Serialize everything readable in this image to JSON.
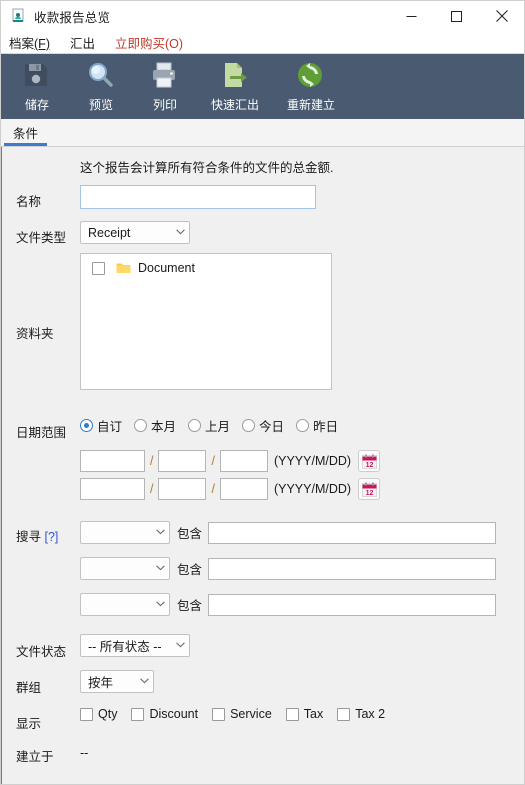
{
  "window": {
    "title": "收款报告总览",
    "icon": "report-app-icon",
    "controls": {
      "minimize": "minimize-icon",
      "maximize": "maximize-icon",
      "close": "close-icon"
    }
  },
  "menubar": {
    "items": [
      {
        "label": "档案",
        "mnemonic": "(F)",
        "accent": false
      },
      {
        "label": "汇出",
        "mnemonic": "",
        "accent": false
      },
      {
        "label": "立即购买",
        "mnemonic": "(O)",
        "accent": true
      }
    ]
  },
  "toolbar": {
    "background": "#4a5a70",
    "items": [
      {
        "label": "储存",
        "icon": "save-floppy-icon"
      },
      {
        "label": "预览",
        "icon": "preview-magnifier-icon"
      },
      {
        "label": "列印",
        "icon": "print-printer-icon"
      },
      {
        "label": "快速汇出",
        "icon": "quick-export-icon"
      },
      {
        "label": "重新建立",
        "icon": "rebuild-refresh-icon"
      }
    ]
  },
  "tabs": [
    {
      "label": "条件",
      "active": true
    }
  ],
  "form": {
    "description": "这个报告会计算所有符合条件的文件的总金额.",
    "name": {
      "label": "名称",
      "value": "",
      "placeholder": ""
    },
    "doc_type": {
      "label": "文件类型",
      "value": "Receipt"
    },
    "folders": {
      "label": "资料夹",
      "items": [
        {
          "label": "Document",
          "checked": false,
          "icon": "folder-icon"
        }
      ]
    },
    "date_range": {
      "label": "日期范围",
      "options": [
        {
          "label": "自订",
          "selected": true
        },
        {
          "label": "本月",
          "selected": false
        },
        {
          "label": "上月",
          "selected": false
        },
        {
          "label": "今日",
          "selected": false
        },
        {
          "label": "昨日",
          "selected": false
        }
      ],
      "format_hint": "(YYYY/M/DD)",
      "separator": "/",
      "calendar_icon": "calendar-icon",
      "rows": [
        {
          "year": "",
          "month": "",
          "day": ""
        },
        {
          "year": "",
          "month": "",
          "day": ""
        }
      ]
    },
    "search": {
      "label": "搜寻",
      "help": "[?]",
      "operator": "包含",
      "rows": [
        {
          "field": "",
          "value": ""
        },
        {
          "field": "",
          "value": ""
        },
        {
          "field": "",
          "value": ""
        }
      ]
    },
    "doc_status": {
      "label": "文件状态",
      "value": "-- 所有状态 --"
    },
    "group": {
      "label": "群组",
      "value": "按年"
    },
    "display": {
      "label": "显示",
      "options": [
        {
          "label": "Qty",
          "checked": false
        },
        {
          "label": "Discount",
          "checked": false
        },
        {
          "label": "Service",
          "checked": false
        },
        {
          "label": "Tax",
          "checked": false
        },
        {
          "label": "Tax 2",
          "checked": false
        }
      ]
    },
    "created_on": {
      "label": "建立于",
      "value": "--"
    }
  }
}
